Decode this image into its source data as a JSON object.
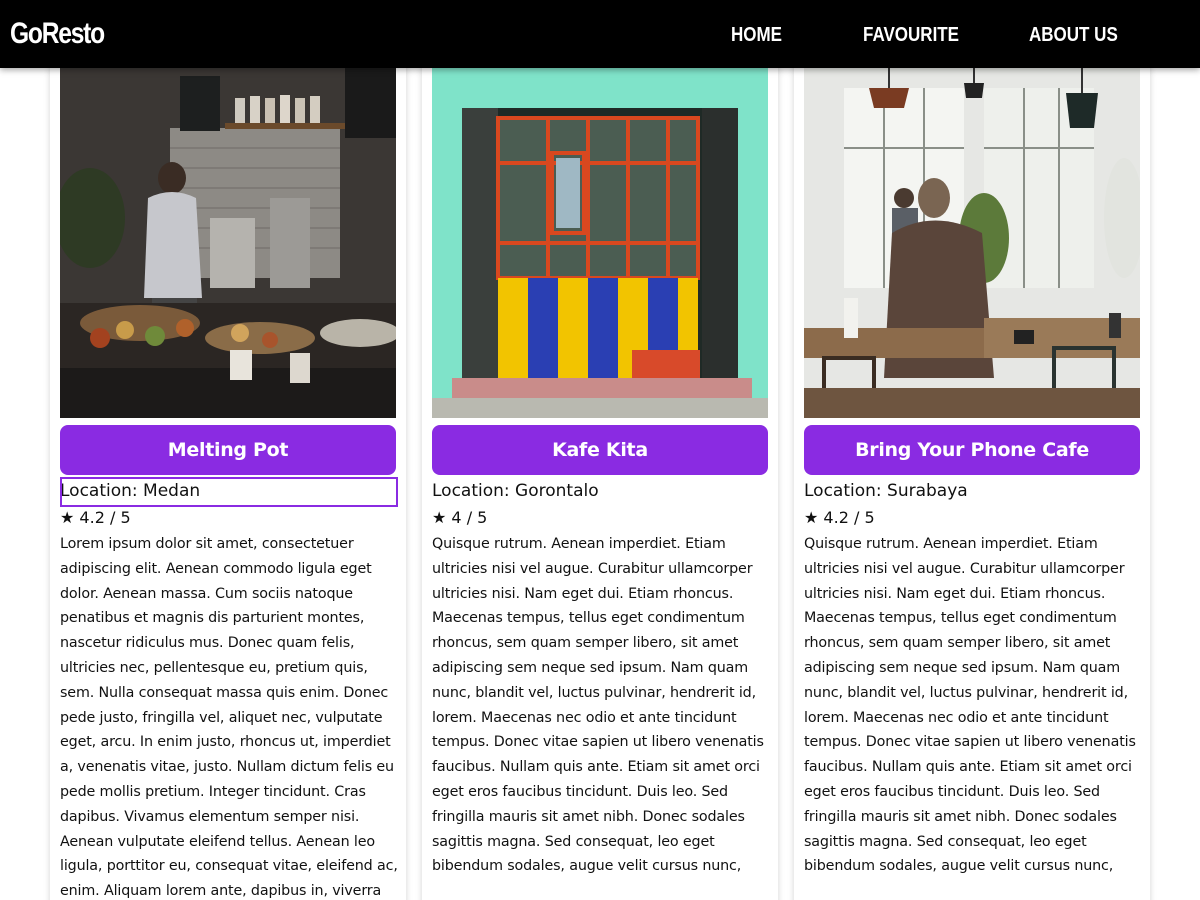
{
  "header": {
    "logo": "GoResto",
    "nav": {
      "home": "HOME",
      "favourite": "FAVOURITE",
      "about": "ABOUT US"
    }
  },
  "restaurants": [
    {
      "name": "Melting Pot",
      "location": "Location: Medan",
      "rating": "★ 4.2 / 5",
      "description": "Lorem ipsum dolor sit amet, consectetuer adipiscing elit. Aenean commodo ligula eget dolor. Aenean massa. Cum sociis natoque penatibus et magnis dis parturient montes, nascetur ridiculus mus. Donec quam felis, ultricies nec, pellentesque eu, pretium quis, sem. Nulla consequat massa quis enim. Donec pede justo, fringilla vel, aliquet nec, vulputate eget, arcu. In enim justo, rhoncus ut, imperdiet a, venenatis vitae, justo. Nullam dictum felis eu pede mollis pretium. Integer tincidunt. Cras dapibus. Vivamus elementum semper nisi. Aenean vulputate eleifend tellus. Aenean leo ligula, porttitor eu, consequat vitae, eleifend ac, enim. Aliquam lorem ante, dapibus in, viverra quis, feugiat a, tellus. Phasellus viverra"
    },
    {
      "name": "Kafe Kita",
      "location": "Location: Gorontalo",
      "rating": "★ 4 / 5",
      "description": "Quisque rutrum. Aenean imperdiet. Etiam ultricies nisi vel augue. Curabitur ullamcorper ultricies nisi. Nam eget dui. Etiam rhoncus. Maecenas tempus, tellus eget condimentum rhoncus, sem quam semper libero, sit amet adipiscing sem neque sed ipsum. Nam quam nunc, blandit vel, luctus pulvinar, hendrerit id, lorem. Maecenas nec odio et ante tincidunt tempus. Donec vitae sapien ut libero venenatis faucibus. Nullam quis ante. Etiam sit amet orci eget eros faucibus tincidunt. Duis leo. Sed fringilla mauris sit amet nibh. Donec sodales sagittis magna. Sed consequat, leo eget bibendum sodales, augue velit cursus nunc,"
    },
    {
      "name": "Bring Your Phone Cafe",
      "location": "Location: Surabaya",
      "rating": "★ 4.2 / 5",
      "description": "Quisque rutrum. Aenean imperdiet. Etiam ultricies nisi vel augue. Curabitur ullamcorper ultricies nisi. Nam eget dui. Etiam rhoncus. Maecenas tempus, tellus eget condimentum rhoncus, sem quam semper libero, sit amet adipiscing sem neque sed ipsum. Nam quam nunc, blandit vel, luctus pulvinar, hendrerit id, lorem. Maecenas nec odio et ante tincidunt tempus. Donec vitae sapien ut libero venenatis faucibus. Nullam quis ante. Etiam sit amet orci eget eros faucibus tincidunt. Duis leo. Sed fringilla mauris sit amet nibh. Donec sodales sagittis magna. Sed consequat, leo eget bibendum sodales, augue velit cursus nunc,"
    }
  ],
  "colors": {
    "accent": "#8a2be2",
    "header_bg": "#000000"
  }
}
